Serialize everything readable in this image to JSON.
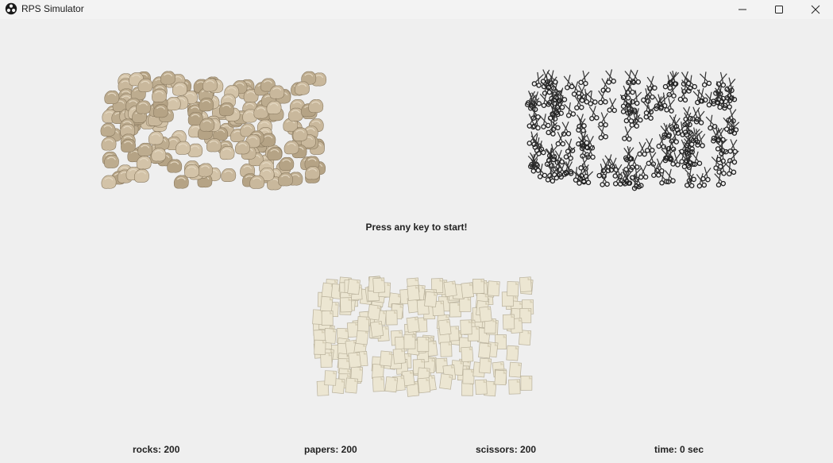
{
  "window": {
    "title": "RPS Simulator",
    "app_icon": "biohazard-icon",
    "controls": [
      "minimize-icon",
      "maximize-icon",
      "close-icon"
    ]
  },
  "game": {
    "start_message": "Press any key to start!",
    "icons": {
      "rock": "rock-icon",
      "paper": "paper-icon",
      "scissors": "scissors-icon"
    },
    "colors": {
      "background": "#efefef",
      "rock": "#c8b79a",
      "paper": "#ebe5d0",
      "scissors": "#3a3a3a"
    }
  },
  "stats": {
    "rocks": "rocks: 200",
    "papers": "papers: 200",
    "scissors": "scissors: 200",
    "time": "time: 0 sec"
  }
}
